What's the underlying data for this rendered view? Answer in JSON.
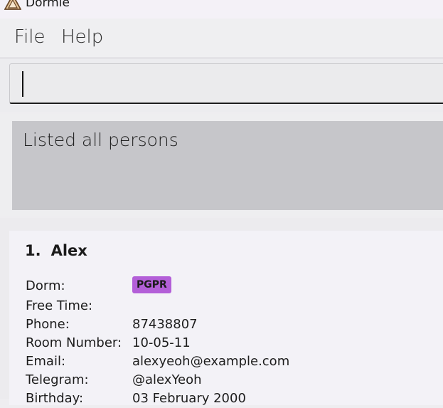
{
  "window": {
    "title": "Dormie",
    "icon": "dormie-app-icon"
  },
  "menu": {
    "items": [
      {
        "label": "File"
      },
      {
        "label": "Help"
      }
    ]
  },
  "command": {
    "value": ""
  },
  "result": {
    "message": "Listed all persons"
  },
  "persons": [
    {
      "index": "1.",
      "name": "Alex",
      "fields": {
        "dorm_label": "Dorm:",
        "dorm_tag": "PGPR",
        "free_time_label": "Free Time:",
        "phone_label": "Phone:",
        "phone": "87438807",
        "room_label": "Room Number:",
        "room": "10-05-11",
        "email_label": "Email:",
        "email": "alexyeoh@example.com",
        "telegram_label": "Telegram:",
        "telegram": "@alexYeoh",
        "birthday_label": "Birthday:",
        "birthday": "03 February 2000"
      }
    }
  ],
  "colors": {
    "tag_background": "#b35fd8",
    "result_background": "#c6c6ca",
    "card_background": "#f3f2f7"
  }
}
